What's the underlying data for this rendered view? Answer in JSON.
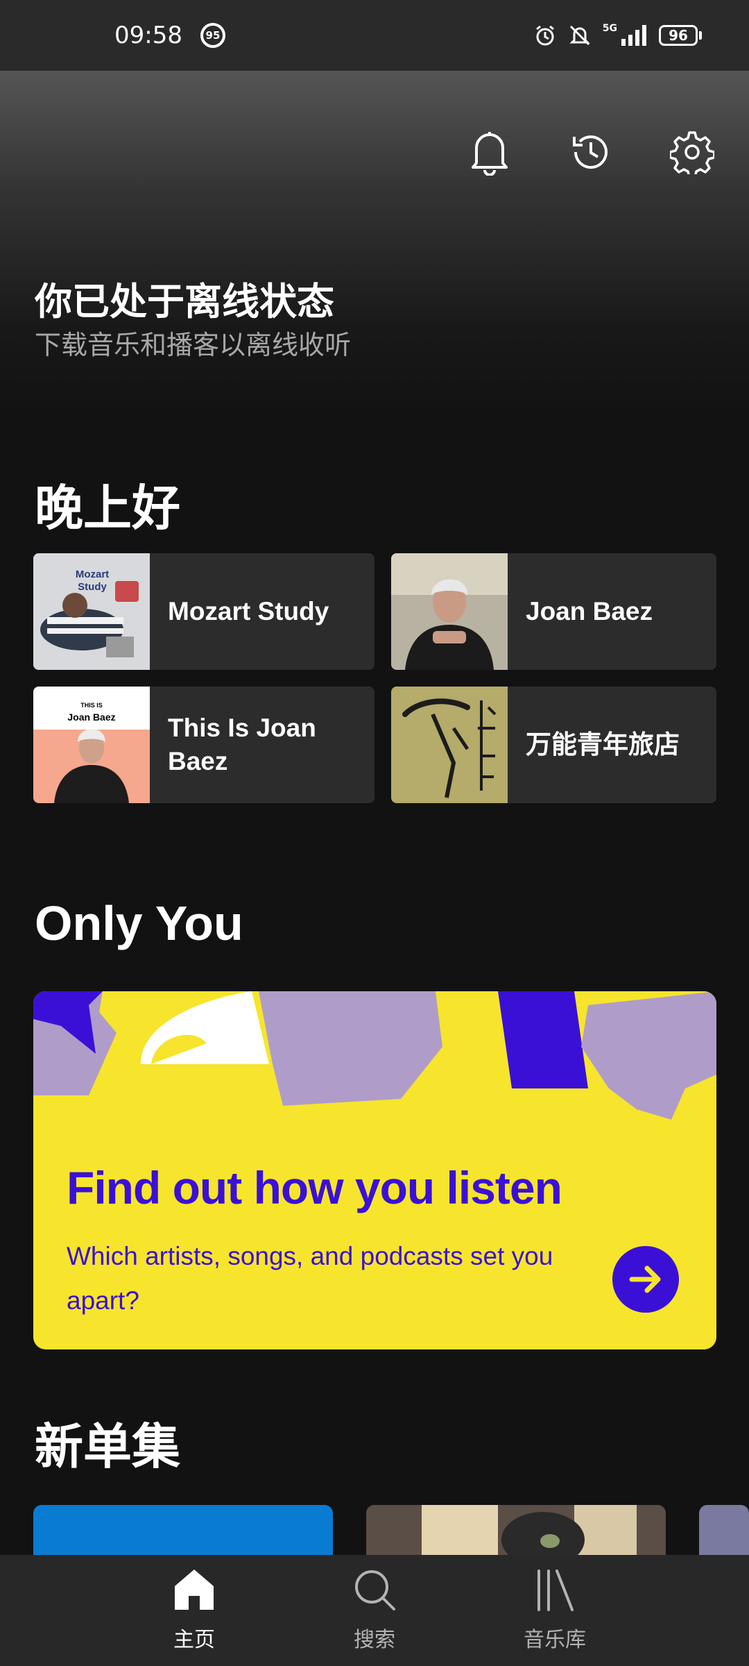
{
  "status_bar": {
    "time": "09:58",
    "badge": "95",
    "network": "5G",
    "battery": "96"
  },
  "header": {
    "icons": [
      "bell-icon",
      "history-icon",
      "settings-icon"
    ]
  },
  "offline": {
    "title": "你已处于离线状态",
    "subtitle": "下载音乐和播客以离线收听"
  },
  "greeting": "晚上好",
  "quick_items": [
    {
      "label": "Mozart Study",
      "art_text": "Mozart Study"
    },
    {
      "label": "Joan Baez"
    },
    {
      "label": "This Is Joan Baez",
      "art_text_top": "THIS IS",
      "art_text_bottom": "Joan Baez"
    },
    {
      "label": "万能青年旅店"
    }
  ],
  "only_you": {
    "section_title": "Only You",
    "banner_title": "Find out how you listen",
    "banner_subtitle": "Which artists, songs, and podcasts set you apart?"
  },
  "new_singles": {
    "section_title": "新单集"
  },
  "colors": {
    "background": "#121212",
    "banner_yellow": "#f6e52c",
    "banner_purple": "#3b10d6",
    "banner_lilac": "#b09cc9"
  },
  "bottom_nav": {
    "items": [
      {
        "label": "主页",
        "icon": "home-icon",
        "active": true
      },
      {
        "label": "搜索",
        "icon": "search-icon",
        "active": false
      },
      {
        "label": "音乐库",
        "icon": "library-icon",
        "active": false
      }
    ]
  }
}
